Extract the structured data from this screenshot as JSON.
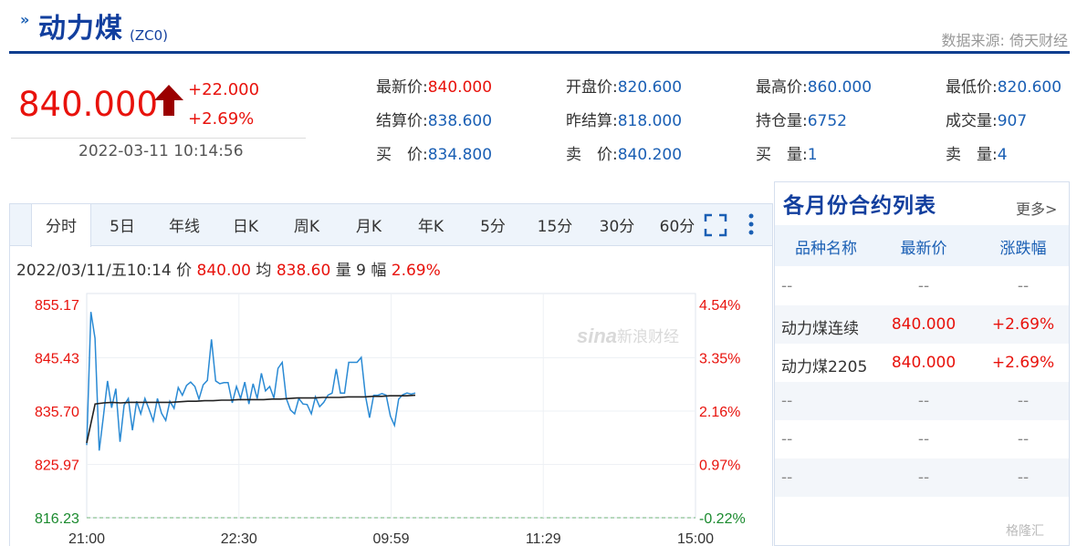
{
  "header": {
    "arrows": "»",
    "title": "动力煤",
    "code": "(ZC0)",
    "source": "数据来源: 倚天财经"
  },
  "quote": {
    "price": "840.000",
    "change": "+22.000",
    "change_pct": "+2.69%",
    "datetime": "2022-03-11 10:14:56",
    "direction": "up",
    "up_color": "#e8120c",
    "arrow_color": "#9b0000"
  },
  "stats": {
    "rows": [
      [
        {
          "label": "最新价:",
          "value": "840.000",
          "color": "red"
        },
        {
          "label": "开盘价:",
          "value": "820.600",
          "color": "blue"
        },
        {
          "label": "最高价:",
          "value": "860.000",
          "color": "blue"
        },
        {
          "label": "最低价:",
          "value": "820.600",
          "color": "blue"
        }
      ],
      [
        {
          "label": "结算价:",
          "value": "838.600",
          "color": "blue"
        },
        {
          "label": "昨结算:",
          "value": "818.000",
          "color": "blue"
        },
        {
          "label": "持仓量:",
          "value": "6752",
          "color": "blue"
        },
        {
          "label": "成交量:",
          "value": "907",
          "color": "blue"
        }
      ],
      [
        {
          "label": "买　价:",
          "value": "834.800",
          "color": "blue"
        },
        {
          "label": "卖　价:",
          "value": "840.200",
          "color": "blue"
        },
        {
          "label": "买　量:",
          "value": "1",
          "color": "blue"
        },
        {
          "label": "卖　量:",
          "value": "4",
          "color": "blue"
        }
      ]
    ]
  },
  "tabs": {
    "items": [
      "分时",
      "5日",
      "年线",
      "日K",
      "周K",
      "月K",
      "年K",
      "5分",
      "15分",
      "30分",
      "60分"
    ],
    "active": "分时",
    "fullscreen_icon": "fullscreen-icon",
    "more_icon": "vertical-dots-icon"
  },
  "infoline": {
    "date": "2022/03/11/五10:14",
    "price_label": "价",
    "price_value": "840.00",
    "avg_label": "均",
    "avg_value": "838.60",
    "vol_label": "量",
    "vol_value": "9",
    "amp_label": "幅",
    "amp_value": "2.69%"
  },
  "chart_data": {
    "type": "line",
    "watermark": "新浪财经",
    "watermark_logo": "sina",
    "y_left_ticks": [
      "855.17",
      "845.43",
      "835.70",
      "825.97",
      "816.23"
    ],
    "y_right_ticks": [
      "4.54%",
      "3.35%",
      "2.16%",
      "0.97%",
      "-0.22%"
    ],
    "x_ticks": [
      "21:00",
      "22:30",
      "09:59",
      "11:29",
      "15:00"
    ],
    "ylim": [
      816.23,
      855.17
    ],
    "grid": true,
    "series": [
      {
        "color": "#2a8ad4",
        "values": [
          829.5,
          853.8,
          849,
          828.5,
          834.6,
          841.2,
          836.3,
          839.8,
          830.1,
          836.8,
          838.0,
          832.2,
          837.5,
          835.2,
          838.0,
          836.0,
          833.9,
          838.0,
          835.3,
          834.0,
          837.5,
          836.2,
          840.0,
          838.6,
          840.4,
          841.0,
          840.2,
          837.9,
          840.5,
          841.3,
          848.8,
          841.2,
          840.7,
          840.9,
          840.9,
          837.2,
          840.2,
          838.0,
          841.0,
          837.0,
          840.7,
          838.0,
          842.6,
          839.4,
          840.2,
          838.1,
          843.5,
          844.6,
          838.0,
          835.9,
          835.2,
          838.0,
          837.0,
          836.9,
          835.2,
          838.3,
          836.5,
          837.3,
          838.6,
          839.0,
          843.4,
          839.0,
          839.0,
          844.6,
          844.6,
          844.6,
          845.5,
          838.6,
          834.5,
          838.6,
          838.6,
          838.9,
          838.6,
          834.8,
          833.1,
          837.9,
          838.7,
          839.0,
          838.8,
          839.0
        ]
      },
      {
        "color": "#222222",
        "values": [
          829.9,
          837.0,
          837.2,
          837.3,
          837.2,
          837.3,
          837.3,
          837.3,
          837.3,
          837.3,
          837.3,
          837.4,
          837.5,
          837.5,
          837.6,
          837.6,
          837.7,
          837.7,
          837.8,
          837.8,
          837.8,
          837.8,
          837.9,
          837.9,
          838.0,
          838.1,
          838.1,
          838.1,
          838.2,
          838.2,
          838.2,
          838.3,
          838.3,
          838.3,
          838.4,
          838.4,
          838.5,
          838.5,
          838.5,
          838.6
        ]
      }
    ]
  },
  "right_table": {
    "title": "各月份合约列表",
    "more": "更多>",
    "headers": [
      "品种名称",
      "最新价",
      "涨跌幅"
    ],
    "rows": [
      [
        "--",
        "--",
        "--"
      ],
      [
        "动力煤连续",
        "840.000",
        "+2.69%"
      ],
      [
        "动力煤2205",
        "840.000",
        "+2.69%"
      ],
      [
        "--",
        "--",
        "--"
      ],
      [
        "--",
        "--",
        "--"
      ],
      [
        "--",
        "--",
        "--"
      ]
    ]
  },
  "footer_logo": "格隆汇"
}
